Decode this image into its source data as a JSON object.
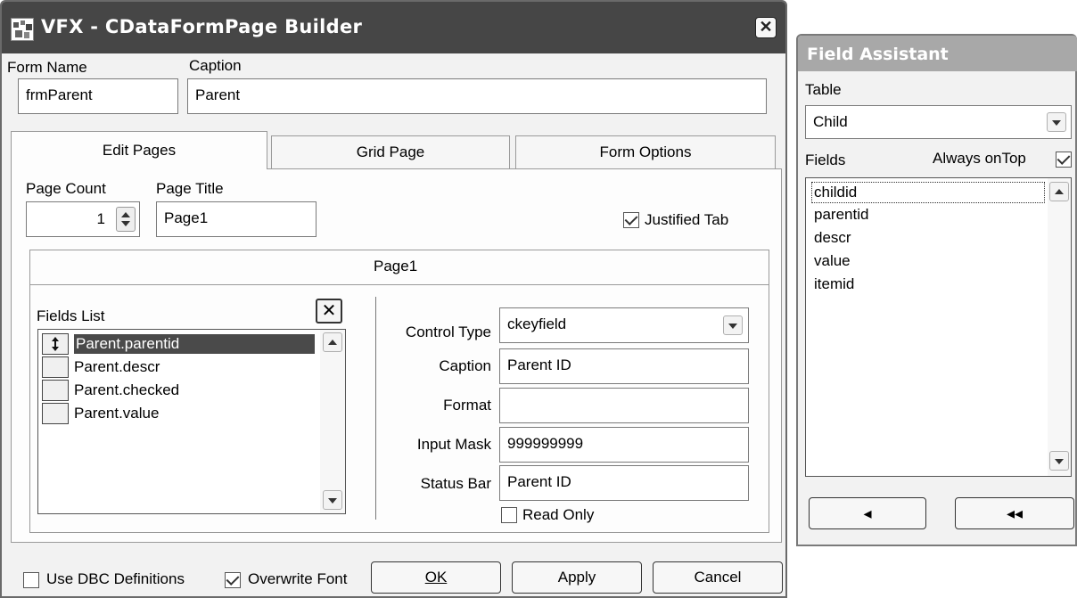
{
  "main": {
    "title": "VFX - CDataFormPage Builder",
    "form_name_label": "Form Name",
    "caption_label": "Caption",
    "form_name_value": "frmParent",
    "caption_value": "Parent",
    "tabs": [
      {
        "label": "Edit Pages",
        "selected": true
      },
      {
        "label": "Grid Page",
        "selected": false
      },
      {
        "label": "Form Options",
        "selected": false
      }
    ],
    "page_count_label": "Page Count",
    "page_title_label": "Page Title",
    "page_count_value": "1",
    "page_title_value": "Page1",
    "justified_tab_label": "Justified Tab",
    "justified_tab_checked": true,
    "inner_tab_label": "Page1",
    "fields_list_label": "Fields List",
    "fields": [
      "Parent.parentid",
      "Parent.descr",
      "Parent.checked",
      "Parent.value"
    ],
    "selected_field_index": 0,
    "control_type_label": "Control Type",
    "control_type_value": "ckeyfield",
    "caption2_label": "Caption",
    "caption2_value": "Parent ID",
    "format_label": "Format",
    "format_value": "",
    "input_mask_label": "Input Mask",
    "input_mask_value": "999999999",
    "status_bar_label": "Status Bar",
    "status_bar_value": "Parent ID",
    "read_only_label": "Read Only",
    "read_only_checked": false,
    "use_dbc_label": "Use DBC Definitions",
    "use_dbc_checked": false,
    "overwrite_font_label": "Overwrite Font",
    "overwrite_font_checked": true,
    "ok_label": "OK",
    "apply_label": "Apply",
    "cancel_label": "Cancel"
  },
  "assistant": {
    "title": "Field Assistant",
    "table_label": "Table",
    "table_value": "Child",
    "fields_label": "Fields",
    "always_on_top_label": "Always onTop",
    "always_on_top_checked": true,
    "fields": [
      "childid",
      "parentid",
      "descr",
      "value",
      "itemid"
    ],
    "focused_index": 0,
    "btn_left_glyph": "◂",
    "btn_left_all_glyph": "◂◂"
  },
  "colors": {
    "title_active": "#464646",
    "title_inactive": "#a8a8a8",
    "selection": "#4a4a4a",
    "window_bg": "#f2f2f2"
  }
}
